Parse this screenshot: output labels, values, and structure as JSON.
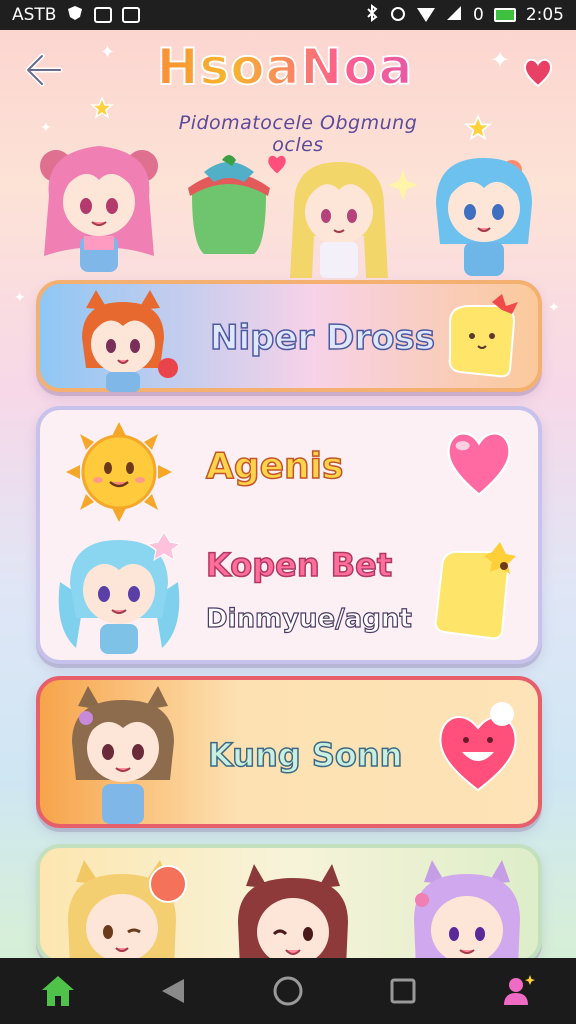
{
  "status_bar": {
    "left_text": "ASTB",
    "right_text": "0",
    "time": "2:05"
  },
  "header": {
    "back_icon": "arrow-left-icon",
    "title": "HsoaNoa",
    "subtitle": "Pidomatocele Obgmung ocles"
  },
  "cards": [
    {
      "label": "Niper Dross",
      "avatar": "orange-cat-girl",
      "side_icon": "yellow-blob-with-bow-icon"
    },
    {
      "label": "Agenis",
      "avatar": "sun-character",
      "side_icon": "pink-heart-icon"
    },
    {
      "label": "Kopen Bet",
      "avatar": "blue-pigtail-girl",
      "side_icon": "yellow-toast-icon"
    },
    {
      "label": "Dinmyue/agnt"
    },
    {
      "label": "Kung Sonn",
      "avatar": "brown-cat-girl",
      "side_icon": "heart-face-icon"
    }
  ],
  "nav": {
    "home_icon": "home-icon",
    "back_icon": "nav-back-icon",
    "home_circle_icon": "nav-home-circle-icon",
    "recents_icon": "nav-recents-icon",
    "profile_icon": "profile-icon"
  },
  "colors": {
    "accent_pink": "#ff5f8d",
    "accent_orange": "#f5b62c",
    "nav_home": "#4fc24a",
    "nav_profile": "#f06cc4"
  }
}
